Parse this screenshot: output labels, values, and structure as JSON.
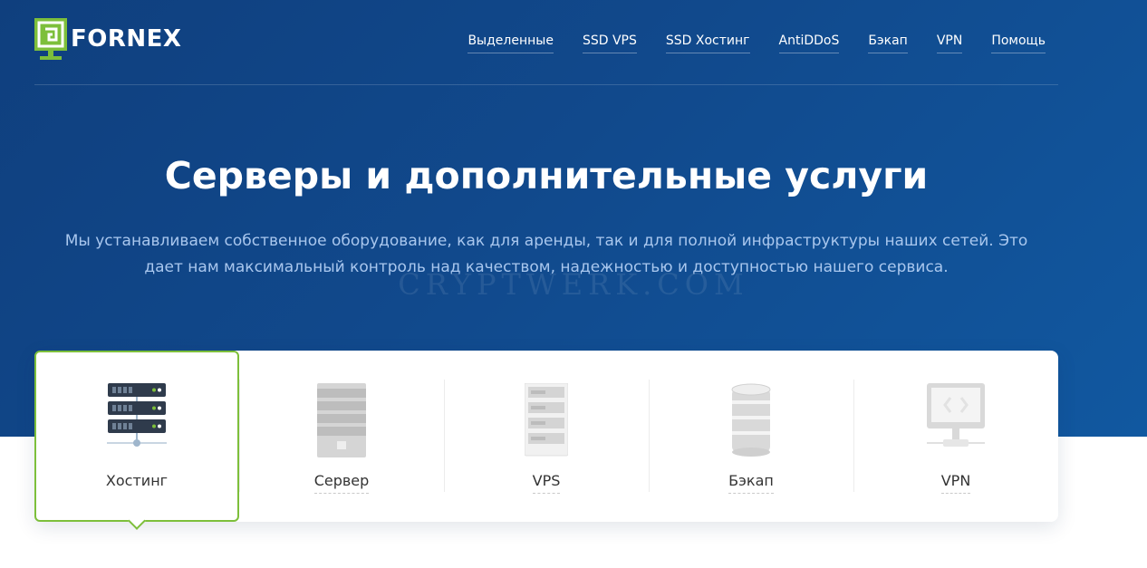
{
  "brand": {
    "name": "FORNEX",
    "logo_icon": "fornex-logo-icon",
    "accent": "#7dbf3b"
  },
  "nav": {
    "items": [
      {
        "label": "Выделенные"
      },
      {
        "label": "SSD VPS"
      },
      {
        "label": "SSD Хостинг"
      },
      {
        "label": "AntiDDoS"
      },
      {
        "label": "Бэкап"
      },
      {
        "label": "VPN"
      },
      {
        "label": "Помощь"
      }
    ]
  },
  "hero": {
    "title": "Серверы и дополнительные услуги",
    "subtitle_line1": "Мы устанавливаем собственное оборудование, как для аренды, так и для полной инфраструктуры наших сетей. Это",
    "subtitle_line2": "дает нам максимальный контроль над качеством, надежностью и доступностью нашего сервиса.",
    "watermark": "CRYPTWERK.COM"
  },
  "services": {
    "selected": "Хостинг",
    "items": [
      {
        "label": "Хостинг",
        "icon": "hosting-server-stack-icon"
      },
      {
        "label": "Сервер",
        "icon": "server-tower-icon"
      },
      {
        "label": "VPS",
        "icon": "vps-rack-icon"
      },
      {
        "label": "Бэкап",
        "icon": "backup-database-icon"
      },
      {
        "label": "VPN",
        "icon": "vpn-monitor-icon"
      }
    ]
  },
  "colors": {
    "hero_start": "#0f3f7e",
    "hero_end": "#1158a0",
    "subtitle": "#a9c7ee"
  }
}
